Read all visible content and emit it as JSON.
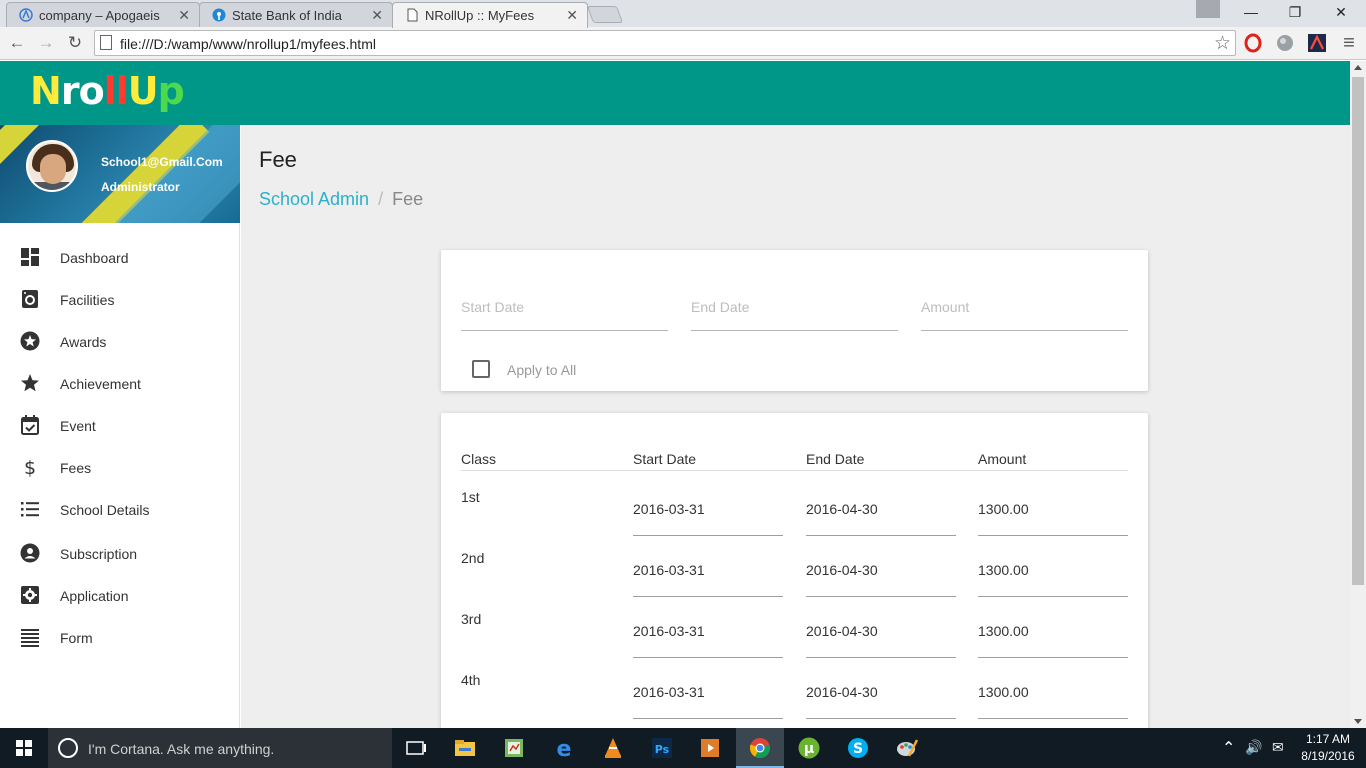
{
  "browser": {
    "tabs": [
      {
        "title": "company – Apogaeis",
        "active": false
      },
      {
        "title": "State Bank of India",
        "active": false
      },
      {
        "title": "NRollUp :: MyFees",
        "active": true
      }
    ],
    "close_glyph": "✕",
    "url": "file:///D:/wamp/www/nrollup1/myfees.html",
    "window_controls": {
      "minimize": "—",
      "maximize": "❐",
      "close": "✕"
    },
    "nav": {
      "back": "←",
      "forward": "→",
      "reload": "↻",
      "star": "☆",
      "menu": "≡"
    }
  },
  "logo": {
    "letters": [
      "N",
      "r",
      "o",
      "l",
      "l",
      "U",
      "p"
    ],
    "colors": [
      "#ffeb3b",
      "#ffffff",
      "#ffffff",
      "#ff3b30",
      "#ff3b30",
      "#ffeb3b",
      "#4cd94c"
    ]
  },
  "profile": {
    "email": "School1@Gmail.Com",
    "role": "Administrator"
  },
  "menu": {
    "items": [
      {
        "label": "Dashboard",
        "icon": "dashboard-icon"
      },
      {
        "label": "Facilities",
        "icon": "facilities-icon"
      },
      {
        "label": "Awards",
        "icon": "awards-icon"
      },
      {
        "label": "Achievement",
        "icon": "star-icon"
      },
      {
        "label": "Event",
        "icon": "calendar-check-icon"
      },
      {
        "label": "Fees",
        "icon": "dollar-icon"
      },
      {
        "label": "School Details",
        "icon": "list-icon"
      },
      {
        "label": "Subscription",
        "icon": "account-circle-icon"
      },
      {
        "label": "Application",
        "icon": "settings-box-icon"
      },
      {
        "label": "Form",
        "icon": "form-lines-icon"
      }
    ]
  },
  "page": {
    "title": "Fee",
    "breadcrumb": {
      "link": "School Admin",
      "separator": "/",
      "current": "Fee"
    }
  },
  "filter": {
    "start_placeholder": "Start Date",
    "end_placeholder": "End Date",
    "amount_placeholder": "Amount",
    "apply_all_label": "Apply to All",
    "apply_all_checked": false
  },
  "fees_table": {
    "headers": [
      "Class",
      "Start Date",
      "End Date",
      "Amount"
    ],
    "rows": [
      {
        "class": "1st",
        "start": "2016-03-31",
        "end": "2016-04-30",
        "amount": "1300.00"
      },
      {
        "class": "2nd",
        "start": "2016-03-31",
        "end": "2016-04-30",
        "amount": "1300.00"
      },
      {
        "class": "3rd",
        "start": "2016-03-31",
        "end": "2016-04-30",
        "amount": "1300.00"
      },
      {
        "class": "4th",
        "start": "2016-03-31",
        "end": "2016-04-30",
        "amount": "1300.00"
      }
    ]
  },
  "taskbar": {
    "search_text": "I'm Cortana. Ask me anything.",
    "time": "1:17 AM",
    "date": "8/19/2016",
    "tray_up": "⌃",
    "volume": "🔊",
    "message": "✉"
  },
  "colors": {
    "header": "#009688",
    "link": "#2bb1c9"
  }
}
